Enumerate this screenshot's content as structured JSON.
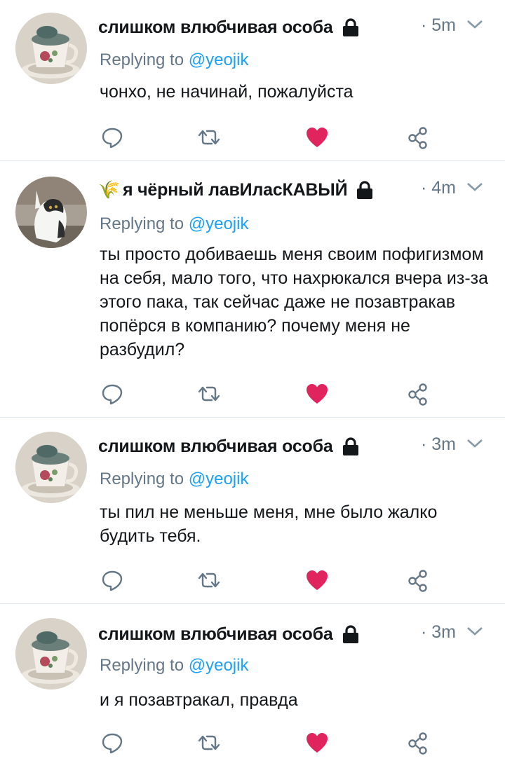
{
  "colors": {
    "text": "#14171a",
    "secondary": "#657786",
    "mention": "#1da1f2",
    "like": "#e0245e",
    "divider": "#e1e8ed"
  },
  "tweets": [
    {
      "author": "слишком влюбчивая особа",
      "protected_icon": "lock-icon",
      "time": "· 5m",
      "reply_prefix": "Replying to",
      "reply_handle": "@yeojik",
      "text": "чонхо, не начинай, пожалуйста",
      "avatar": "teacup-avatar",
      "liked": true
    },
    {
      "author_emoji": "🌾",
      "author": "я чёрный лавИласКАВЫЙ",
      "protected_icon": "lock-icon",
      "time": "· 4m",
      "reply_prefix": "Replying to",
      "reply_handle": "@yeojik",
      "text": "ты просто добиваешь меня своим пофигизмом на себя, мало того, что нахрюкался вчера из-за этого пака, так сейчас даже не позавтракав попёрся в компанию? почему меня не разбудил?",
      "avatar": "cat-avatar",
      "liked": true
    },
    {
      "author": "слишком влюбчивая особа",
      "protected_icon": "lock-icon",
      "time": "· 3m",
      "reply_prefix": "Replying to",
      "reply_handle": "@yeojik",
      "text": "ты пил не меньше меня, мне было жалко будить тебя.",
      "avatar": "teacup-avatar",
      "liked": true
    },
    {
      "author": "слишком влюбчивая особа",
      "protected_icon": "lock-icon",
      "time": "· 3m",
      "reply_prefix": "Replying to",
      "reply_handle": "@yeojik",
      "text": "и я позавтракал, правда",
      "avatar": "teacup-avatar",
      "liked": true
    }
  ]
}
